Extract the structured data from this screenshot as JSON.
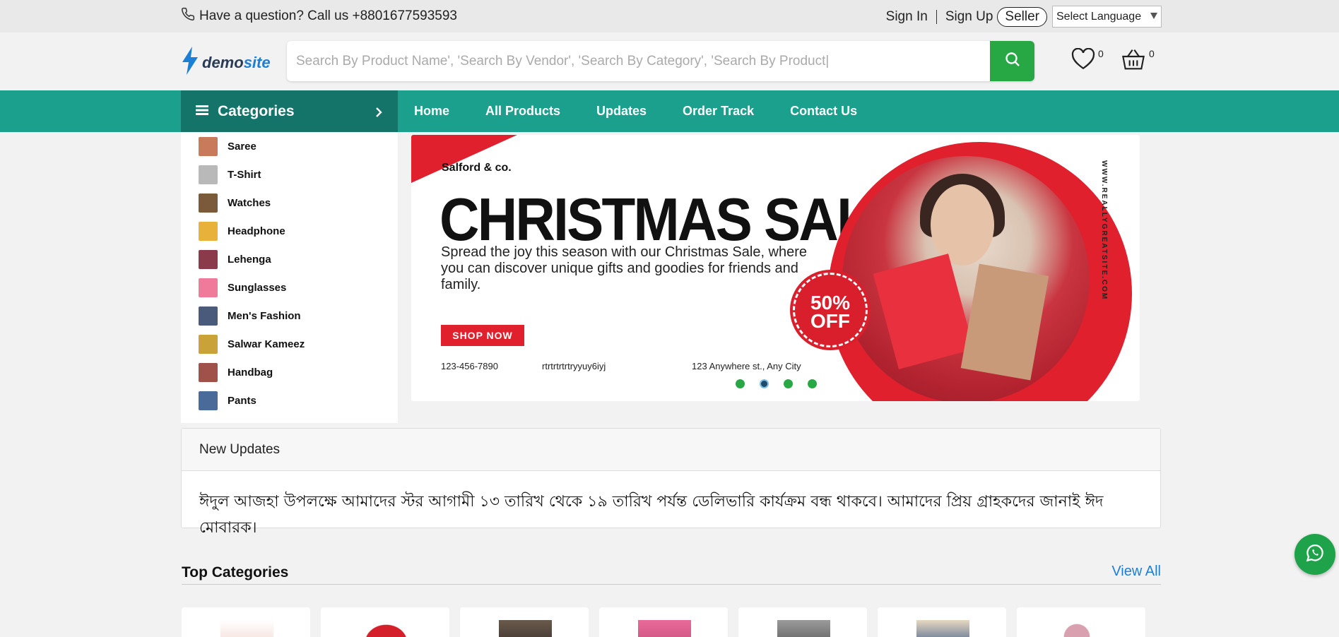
{
  "topbar": {
    "phone_text": "Have a question? Call us +8801677593593",
    "sign_in": "Sign In",
    "sign_up": "Sign Up",
    "seller": "Seller",
    "language": "Select Language"
  },
  "header": {
    "logo_main": "demo",
    "logo_accent": "site",
    "search_placeholder": "Search By Product Name', 'Search By Vendor', 'Search By Category', 'Search By Product|",
    "wishlist_count": "0",
    "cart_count": "0"
  },
  "nav": {
    "categories_label": "Categories",
    "items": [
      "Home",
      "All Products",
      "Updates",
      "Order Track",
      "Contact Us"
    ]
  },
  "categories": [
    {
      "label": "Saree",
      "color": "#c97a5a"
    },
    {
      "label": "T-Shirt",
      "color": "#b9b9b9"
    },
    {
      "label": "Watches",
      "color": "#7a5a3a"
    },
    {
      "label": "Headphone",
      "color": "#e8b23a"
    },
    {
      "label": "Lehenga",
      "color": "#8a3a4a"
    },
    {
      "label": "Sunglasses",
      "color": "#f07a9a"
    },
    {
      "label": "Men's Fashion",
      "color": "#4a5a7a"
    },
    {
      "label": "Salwar Kameez",
      "color": "#c9a23a"
    },
    {
      "label": "Handbag",
      "color": "#a0524a"
    },
    {
      "label": "Pants",
      "color": "#4a6a9a"
    }
  ],
  "banner": {
    "brand": "Salford & co.",
    "title": "CHRISTMAS SALE",
    "description": "Spread the joy this season with our Christmas Sale, where you can discover unique gifts and goodies for friends and family.",
    "cta": "SHOP NOW",
    "phone": "123-456-7890",
    "code": "rtrtrtrtrtryyuy6iyj",
    "address": "123 Anywhere st., Any City",
    "badge_line1": "50%",
    "badge_line2": "OFF",
    "website": "WWW.REALLYGREATSITE.COM",
    "slide_count": 4,
    "active_slide": 2
  },
  "updates": {
    "heading": "New Updates",
    "message": "ঈদুল আজহা উপলক্ষে আমাদের স্টর আগামী ১৩ তারিখ থেকে ১৯ তারিখ পর্যন্ত ডেলিভারি কার্যক্রম বন্ধ থাকবে। আমাদের প্রিয় গ্রাহকদের জানাই ঈদ মোবারক।"
  },
  "top_categories": {
    "heading": "Top Categories",
    "view_all": "View All"
  },
  "colors": {
    "accent": "#1aa08c",
    "accent_dark": "#15746a",
    "search_button": "#27a845",
    "banner_red": "#e0202d",
    "link": "#1b7fd6"
  }
}
